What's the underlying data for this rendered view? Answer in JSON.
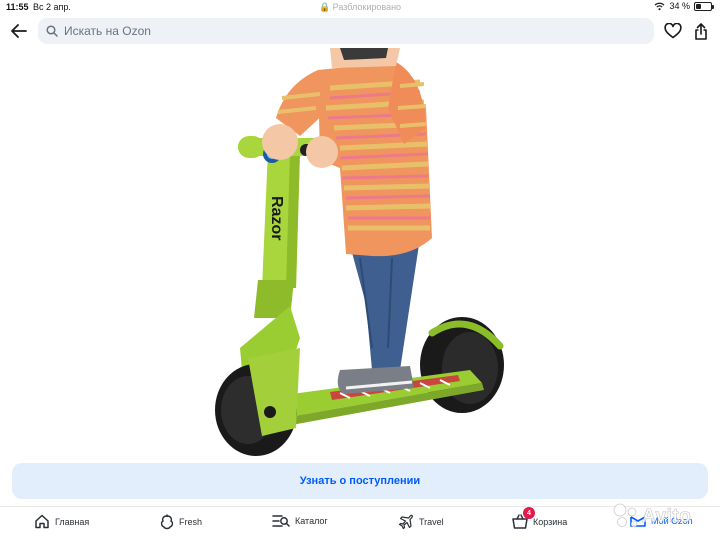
{
  "status_bar": {
    "time": "11:55",
    "date": "Вс 2 апр.",
    "center": "Разблокировано",
    "battery": "34 %",
    "battery_level": 0.34
  },
  "header": {
    "search_placeholder": "Искать на Ozon"
  },
  "product": {
    "brand_text": "Razor"
  },
  "notify_button": "Узнать о поступлении",
  "tabs": [
    {
      "label": "Главная",
      "icon": "home-icon"
    },
    {
      "label": "Fresh",
      "icon": "fresh-icon"
    },
    {
      "label": "Каталог",
      "icon": "catalog-icon"
    },
    {
      "label": "Travel",
      "icon": "plane-icon"
    },
    {
      "label": "Корзина",
      "icon": "basket-icon",
      "badge": "4"
    },
    {
      "label": "Мой Ozon",
      "icon": "profile-icon"
    }
  ],
  "watermark": "Avito",
  "colors": {
    "accent": "#005bff",
    "button_bg": "#e3eefc",
    "badge": "#e6194b",
    "scooter": "#9acd32"
  }
}
